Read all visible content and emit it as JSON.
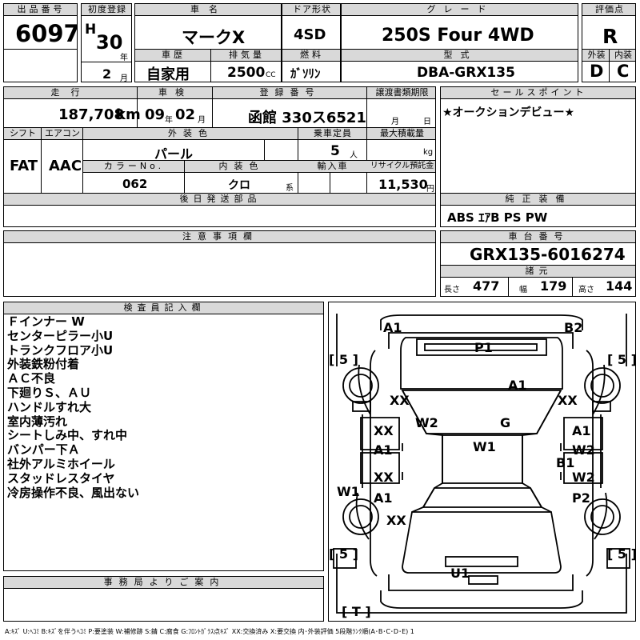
{
  "header": {
    "lot_no_label": "出品番号",
    "lot_no": "6097",
    "first_reg_label": "初度登録",
    "era": "H",
    "year": "30",
    "year_unit": "年",
    "month": "2",
    "month_unit": "月",
    "car_name_label": "車名",
    "car_name": "マークX",
    "door_label": "ドア形状",
    "door": "4SD",
    "grade_label": "グレード",
    "grade": "250S Four 4WD",
    "score_label": "評価点",
    "score": "R",
    "history_label": "車歴",
    "history": "自家用",
    "displacement_label": "排気量",
    "displacement": "2500",
    "displacement_unit": "CC",
    "fuel_label": "燃料",
    "fuel": "ｶﾞｿﾘﾝ",
    "model_label": "型式",
    "model": "DBA-GRX135",
    "exterior_label": "外装",
    "exterior": "D",
    "interior_label": "内装",
    "interior": "C"
  },
  "row2": {
    "mileage_label": "走行",
    "mileage": "187,708",
    "mileage_unit": "km",
    "inspection_label": "車検",
    "inspection_year": "09",
    "inspection_year_unit": "年",
    "inspection_month": "02",
    "inspection_month_unit": "月",
    "plate_label": "登録番号",
    "plate": "函館 330ス6521",
    "transfer_label": "譲渡書類期限",
    "transfer_month_unit": "月",
    "transfer_day_unit": "日",
    "shift_label": "シフト",
    "shift": "FAT",
    "ac_label": "エアコン",
    "ac": "AAC",
    "color_label": "外装色",
    "color": "パール",
    "capacity_label": "乗車定員",
    "capacity": "5",
    "capacity_unit": "人",
    "max_load_label": "最大積載量",
    "max_load_unit": "kg",
    "color_no_label": "カラーNo.",
    "color_no": "062",
    "interior_color_label": "内装色",
    "interior_color": "クロ",
    "interior_color_unit": "系",
    "import_label": "輸入車",
    "recycle_label": "リサイクル預託金",
    "recycle": "11,530",
    "recycle_unit": "円",
    "later_parts_label": "後日発送部品"
  },
  "sales_point": {
    "label": "セールスポイント",
    "text": "★オークションデビュー★"
  },
  "equipment": {
    "label": "純正装備",
    "text": "ABS ｴｱB PS PW"
  },
  "notes": {
    "label": "注意事項欄"
  },
  "chassis": {
    "label": "車台番号",
    "number": "GRX135-6016274",
    "specs_label": "諸元",
    "length_label": "長さ",
    "length": "477",
    "width_label": "幅",
    "width": "179",
    "height_label": "高さ",
    "height": "144"
  },
  "inspector": {
    "label": "検査員記入欄",
    "lines": [
      "Ｆインナー W",
      "センターピラー小U",
      "トランクフロア小U",
      "外装鉄粉付着",
      "ＡＣ不良",
      "下廻りＳ、ＡＵ",
      "ハンドルすれ大",
      "室内薄汚れ",
      "シートしみ中、すれ中",
      "バンパー下Ａ",
      "社外アルミホイール",
      "スタッドレスタイヤ",
      "冷房操作不良、風出ない"
    ]
  },
  "office": {
    "label": "事務局よりご案内"
  },
  "diagram": {
    "marks": [
      "A1",
      "B2",
      "P1",
      "A1",
      "XX",
      "XX",
      "W2",
      "G",
      "XX",
      "A1",
      "W1",
      "A1",
      "W2",
      "B1",
      "XX",
      "W2",
      "W1",
      "A1",
      "P2",
      "XX",
      "U1"
    ],
    "tires": [
      "[ 5 ]",
      "[ 5 ]",
      "[ 5 ]",
      "[ 5 ]"
    ],
    "spare": "[ T ]"
  },
  "legend": "A:ｷｽﾞ U:ﾍｺﾐ B:ｷｽﾞを伴うﾍｺﾐ P:要塗装 W:補修跡 S:錆 C:腐食 G:ﾌﾛﾝﾄｶﾞﾗｽ点ｷｽﾞ XX:交換済み X:要交換 内･外装評価 5段階ﾗﾝｸ順(A･B･C･D･E) 1"
}
